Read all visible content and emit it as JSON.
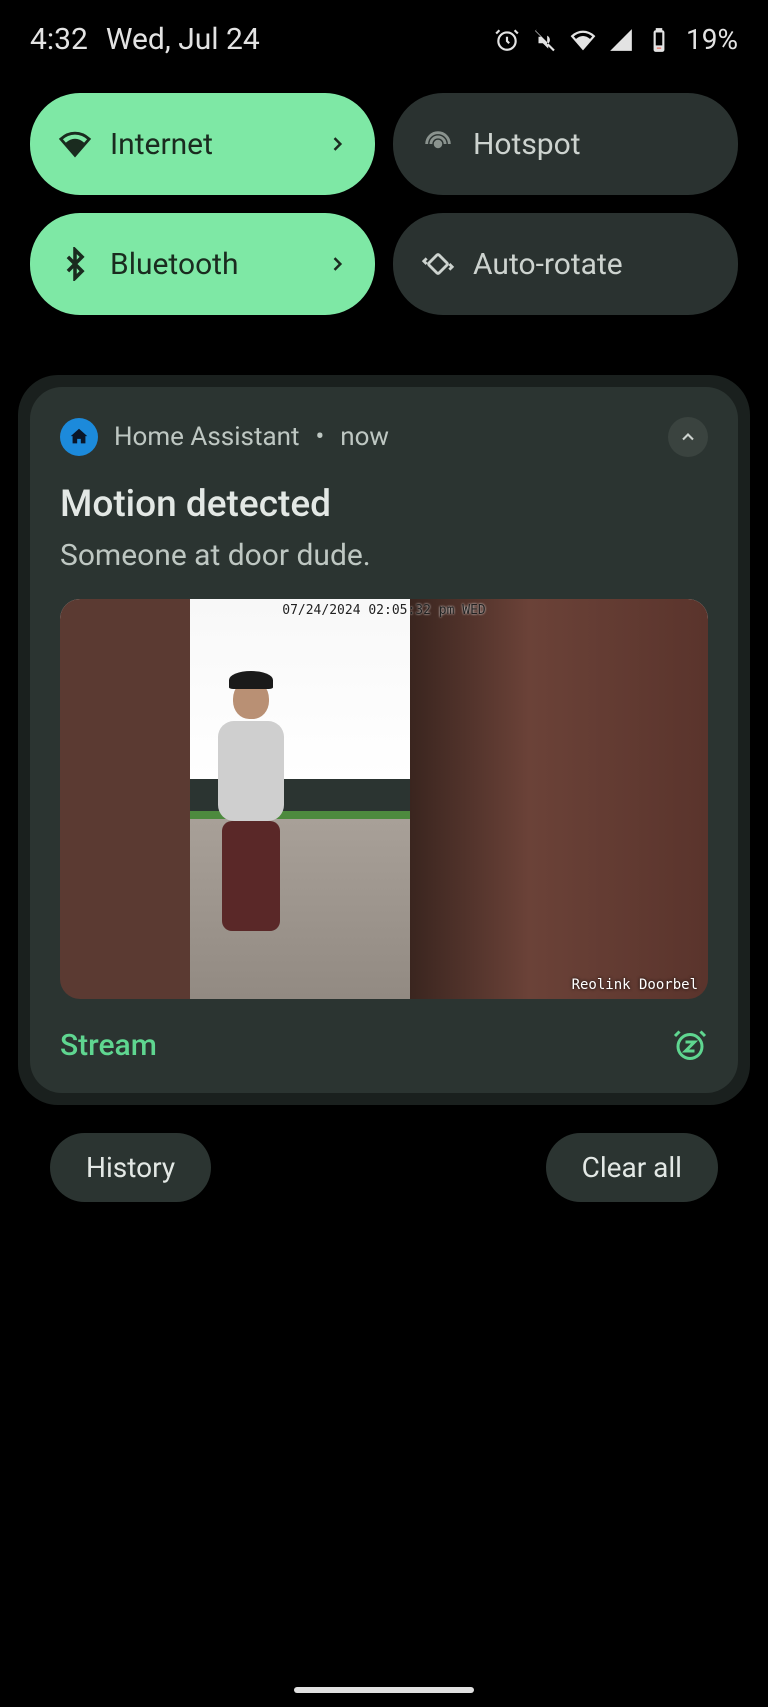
{
  "status": {
    "time": "4:32",
    "date": "Wed, Jul 24",
    "battery_pct": "19%"
  },
  "qs": {
    "tiles": [
      {
        "label": "Internet",
        "active": true,
        "chevron": true
      },
      {
        "label": "Hotspot",
        "active": false,
        "chevron": false
      },
      {
        "label": "Bluetooth",
        "active": true,
        "chevron": true
      },
      {
        "label": "Auto-rotate",
        "active": false,
        "chevron": false
      }
    ]
  },
  "notification": {
    "app": "Home Assistant",
    "separator": "•",
    "time": "now",
    "title": "Motion detected",
    "body": "Someone at door dude.",
    "image_overlay": "07/24/2024 02:05:32 pm WED",
    "image_watermark": "Reolink Doorbel",
    "action": "Stream"
  },
  "bottom": {
    "history": "History",
    "clear_all": "Clear all"
  }
}
